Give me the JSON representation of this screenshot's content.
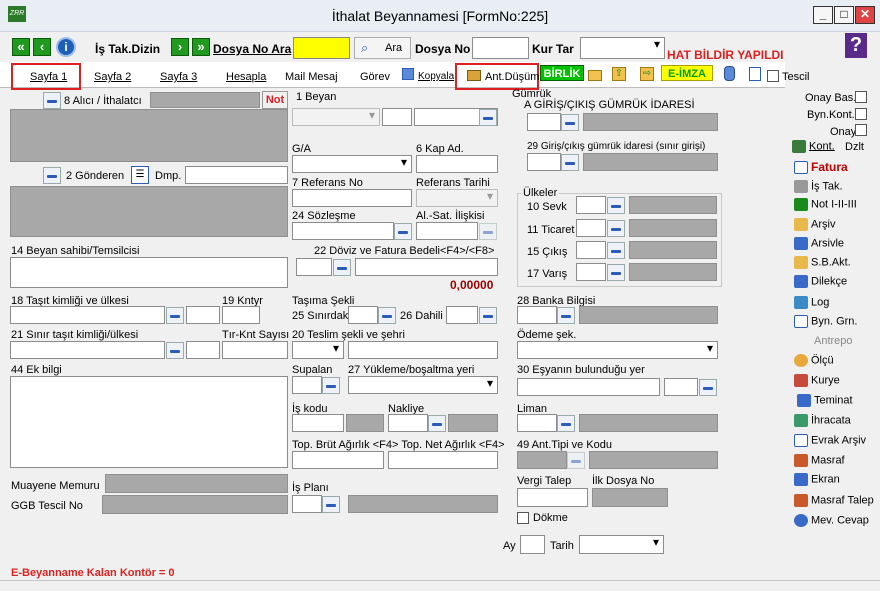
{
  "window": {
    "title": "İthalat Beyannamesi [FormNo:225]",
    "min": "_",
    "max": "□",
    "close": "✕",
    "logo": "ZRR",
    "help": "?"
  },
  "toolbar": {
    "is_takip": "İş Tak.Dizin",
    "dosya_no_ara": "Dosya No Ara",
    "ara": "Ara",
    "dosya_no": "Dosya No",
    "kur_tar": "Kur Tar",
    "hat_bildir": "HAT BİLDİR YAPILDI",
    "nav_prev2": "«",
    "nav_prev": "‹",
    "nav_info": "i",
    "nav_next": "›",
    "nav_next2": "»"
  },
  "tabs": {
    "sayfa1": "Sayfa 1",
    "sayfa2": "Sayfa 2",
    "sayfa3": "Sayfa 3",
    "hesapla": "Hesapla",
    "mail": "Mail Mesaj",
    "gorev": "Görev",
    "kopyala": "Kopyala",
    "ant_dusum": "Ant.Düşüm",
    "birlik": "BİRLİK",
    "e_imza": "E-İMZA",
    "tescil": "Tescil"
  },
  "left": {
    "alici": "8 Alıcı / İthalatcı",
    "not": "Not",
    "gonderen": "2 Gönderen",
    "dmp": "Dmp.",
    "beyan_sahibi": "14 Beyan sahibi/Temsilcisi",
    "tasit": "18 Taşıt kimliği ve ülkesi",
    "kntyr": "19 Kntyr",
    "sinir_tasit": "21 Sınır taşıt kimliği/ülkesi",
    "tir_knt": "Tır-Knt Sayısı",
    "ek_bilgi": "44 Ek bilgi",
    "muayene": "Muayene Memuru",
    "ggb": "GGB Tescil No",
    "kontor": "E-Beyanname Kalan Kontör = 0"
  },
  "mid": {
    "beyan": "1 Beyan",
    "ga": "G/A",
    "kap": "6 Kap Ad.",
    "ref_no": "7 Referans No",
    "ref_tarih": "Referans Tarihi",
    "sozlesme": "24 Sözleşme",
    "al_sat": "Al.-Sat. İlişkisi",
    "doviz": "22 Döviz ve Fatura Bedeli<F4>/<F8>",
    "amount": "0,00000",
    "tasima": "Taşıma Şekli",
    "sinirdaki": "25 Sınırdaki",
    "dahili": "26 Dahili",
    "teslim": "20 Teslim şekli ve şehri",
    "supalan": "Supalan",
    "yukleme": "27 Yükleme/boşaltma yeri",
    "is_kodu": "İş kodu",
    "nakliye": "Nakliye",
    "agirlik": "Top. Brüt Ağırlık <F4> Top. Net Ağırlık <F4>",
    "is_plani": "İş Planı"
  },
  "right": {
    "gumruk": "Gümrük",
    "giris_cikis": "A GİRİŞ/ÇIKIŞ GÜMRÜK İDARESİ",
    "giris_sinir": "29 Giriş/çıkış gümrük idaresi (sınır girişi)",
    "ulkeler": "Ülkeler",
    "sevk": "10 Sevk",
    "ticaret": "11 Ticaret",
    "cikis": "15 Çıkış",
    "varis": "17 Varış",
    "banka": "28 Banka Bilgisi",
    "odeme": "Ödeme şek.",
    "esya": "30 Eşyanın bulunduğu yer",
    "liman": "Liman",
    "ant_tipi": "49 Ant.Tipi ve Kodu",
    "vergi": "Vergi Talep",
    "ilk_dosya": "İlk Dosya No",
    "dokme": "Dökme",
    "ay": "Ay",
    "tarih": "Tarih"
  },
  "side": {
    "onay_bas": "Onay Bas.",
    "byn_kont": "Byn.Kont.",
    "onay": "Onay",
    "kont": "Kont.",
    "dzlt": "Dzlt",
    "fatura": "Fatura",
    "is_tak": "İş Tak.",
    "not_i": "Not I-II-III",
    "arsiv": "Arşiv",
    "arsivle": "Arsivle",
    "sb_akt": "S.B.Akt.",
    "dilekce": "Dilekçe",
    "log": "Log",
    "byn_grn": "Byn. Grn.",
    "antrepo": "Antrepo",
    "olcu": "Ölçü",
    "kurye": "Kurye",
    "teminat": "Teminat",
    "ihracata": "İhracata",
    "evrak": "Evrak Arşiv",
    "masraf": "Masraf",
    "ekran": "Ekran",
    "masraf_talep": "Masraf Talep",
    "mev_cevap": "Mev. Cevap"
  }
}
